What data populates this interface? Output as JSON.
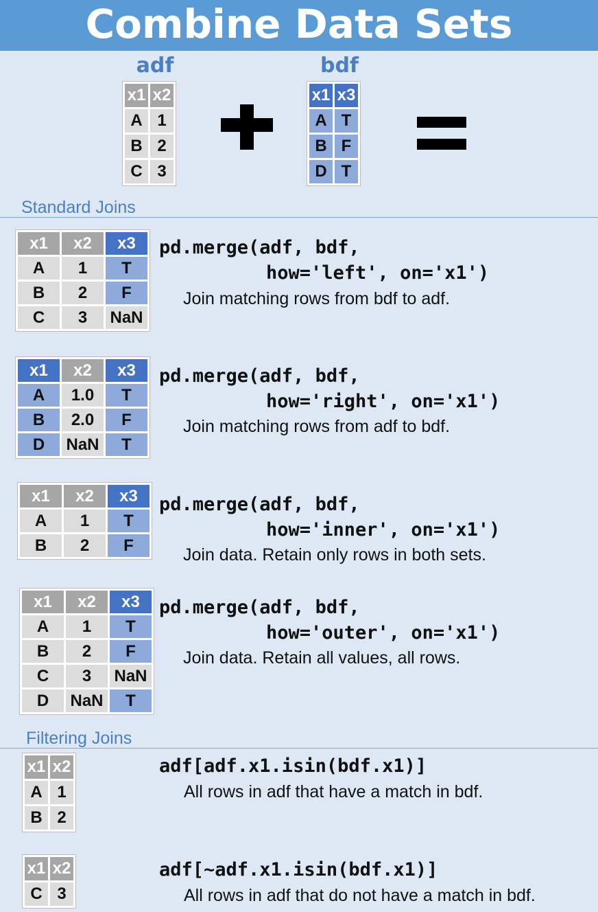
{
  "title": "Combine Data Sets",
  "adf": {
    "label": "adf",
    "headers": [
      "x1",
      "x2"
    ],
    "rows": [
      [
        "A",
        "1"
      ],
      [
        "B",
        "2"
      ],
      [
        "C",
        "3"
      ]
    ]
  },
  "bdf": {
    "label": "bdf",
    "headers": [
      "x1",
      "x3"
    ],
    "rows": [
      [
        "A",
        "T"
      ],
      [
        "B",
        "F"
      ],
      [
        "D",
        "T"
      ]
    ]
  },
  "standard_joins": {
    "heading": "Standard Joins",
    "items": [
      {
        "code_line1": "pd.merge(adf, bdf,",
        "code_line2": "how='left', on='x1')",
        "description": "Join matching rows from bdf to adf.",
        "headers": [
          "x1",
          "x2",
          "x3"
        ],
        "rows": [
          [
            "A",
            "1",
            "T"
          ],
          [
            "B",
            "2",
            "F"
          ],
          [
            "C",
            "3",
            "NaN"
          ]
        ]
      },
      {
        "code_line1": "pd.merge(adf, bdf,",
        "code_line2": "how='right', on='x1')",
        "description": "Join matching rows from adf to bdf.",
        "headers": [
          "x1",
          "x2",
          "x3"
        ],
        "rows": [
          [
            "A",
            "1.0",
            "T"
          ],
          [
            "B",
            "2.0",
            "F"
          ],
          [
            "D",
            "NaN",
            "T"
          ]
        ]
      },
      {
        "code_line1": "pd.merge(adf, bdf,",
        "code_line2": "how='inner', on='x1')",
        "description": "Join data. Retain only rows in both sets.",
        "headers": [
          "x1",
          "x2",
          "x3"
        ],
        "rows": [
          [
            "A",
            "1",
            "T"
          ],
          [
            "B",
            "2",
            "F"
          ]
        ]
      },
      {
        "code_line1": "pd.merge(adf, bdf,",
        "code_line2": "how='outer', on='x1')",
        "description": "Join data. Retain all values, all rows.",
        "headers": [
          "x1",
          "x2",
          "x3"
        ],
        "rows": [
          [
            "A",
            "1",
            "T"
          ],
          [
            "B",
            "2",
            "F"
          ],
          [
            "C",
            "3",
            "NaN"
          ],
          [
            "D",
            "NaN",
            "T"
          ]
        ]
      }
    ]
  },
  "filtering_joins": {
    "heading": "Filtering Joins",
    "items": [
      {
        "code": "adf[adf.x1.isin(bdf.x1)]",
        "description": "All rows in adf that have a match in bdf.",
        "headers": [
          "x1",
          "x2"
        ],
        "rows": [
          [
            "A",
            "1"
          ],
          [
            "B",
            "2"
          ]
        ]
      },
      {
        "code": "adf[~adf.x1.isin(bdf.x1)]",
        "description": "All rows in adf that do not have a match in bdf.",
        "headers": [
          "x1",
          "x2"
        ],
        "rows": [
          [
            "C",
            "3"
          ]
        ]
      }
    ]
  },
  "colors": {
    "header_bg": "#5b9bd5",
    "page_bg": "#dde8f4",
    "gray_header": "#a6a6a6",
    "gray_cell": "#dcdcdc",
    "blue_header": "#4472c4",
    "blue_cell": "#8eaadb",
    "section_text": "#4a7fc1"
  },
  "icons": [
    "plus-icon",
    "equals-icon"
  ]
}
